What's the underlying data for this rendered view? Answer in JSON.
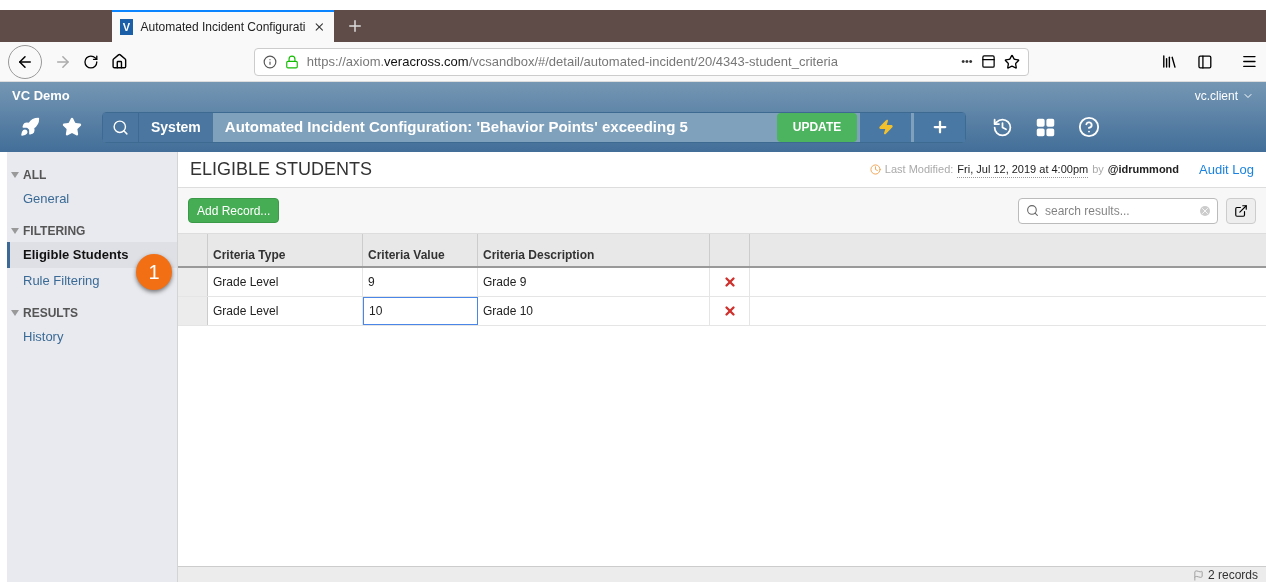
{
  "browser": {
    "logo_letter": "V",
    "tab_title": "Automated Incident Configurati",
    "url_host_prefix": "https://axiom.",
    "url_host": "veracross.com",
    "url_path": "/vcsandbox/#/detail/automated-incident/20/4343-student_criteria",
    "menu_dots": "•••"
  },
  "app": {
    "instance": "VC Demo",
    "user": "vc.client",
    "breadcrumb_root": "System",
    "breadcrumb_title": "Automated Incident Configuration: 'Behavior Points' exceeding 5",
    "update_button": "UPDATE"
  },
  "sidebar": [
    {
      "title": "ALL",
      "expanded": true,
      "items": [
        {
          "label": "General",
          "selected": false
        }
      ]
    },
    {
      "title": "FILTERING",
      "expanded": true,
      "items": [
        {
          "label": "Eligible Students",
          "selected": true
        },
        {
          "label": "Rule Filtering",
          "selected": false
        }
      ]
    },
    {
      "title": "RESULTS",
      "expanded": true,
      "items": [
        {
          "label": "History",
          "selected": false
        }
      ]
    }
  ],
  "annotation": "1",
  "page": {
    "title": "ELIGIBLE STUDENTS",
    "modified_label": "Last Modified:",
    "modified_date": "Fri, Jul 12, 2019 at 4:00pm",
    "modified_by": "by",
    "modified_user": "@idrummond",
    "audit_link": "Audit Log",
    "add_button": "Add Record...",
    "search_placeholder": "search results..."
  },
  "table": {
    "columns": [
      "Criteria Type",
      "Criteria Value",
      "Criteria Description"
    ],
    "rows": [
      {
        "cells": [
          {
            "text": "Grade Level",
            "selected": false
          },
          {
            "text": "9",
            "selected": false
          },
          {
            "text": "Grade 9",
            "selected": false
          }
        ]
      },
      {
        "cells": [
          {
            "text": "Grade Level",
            "selected": false
          },
          {
            "text": "10",
            "selected": true
          },
          {
            "text": "Grade 10",
            "selected": false
          }
        ]
      }
    ]
  },
  "status_bar": {
    "count": "2 records"
  }
}
